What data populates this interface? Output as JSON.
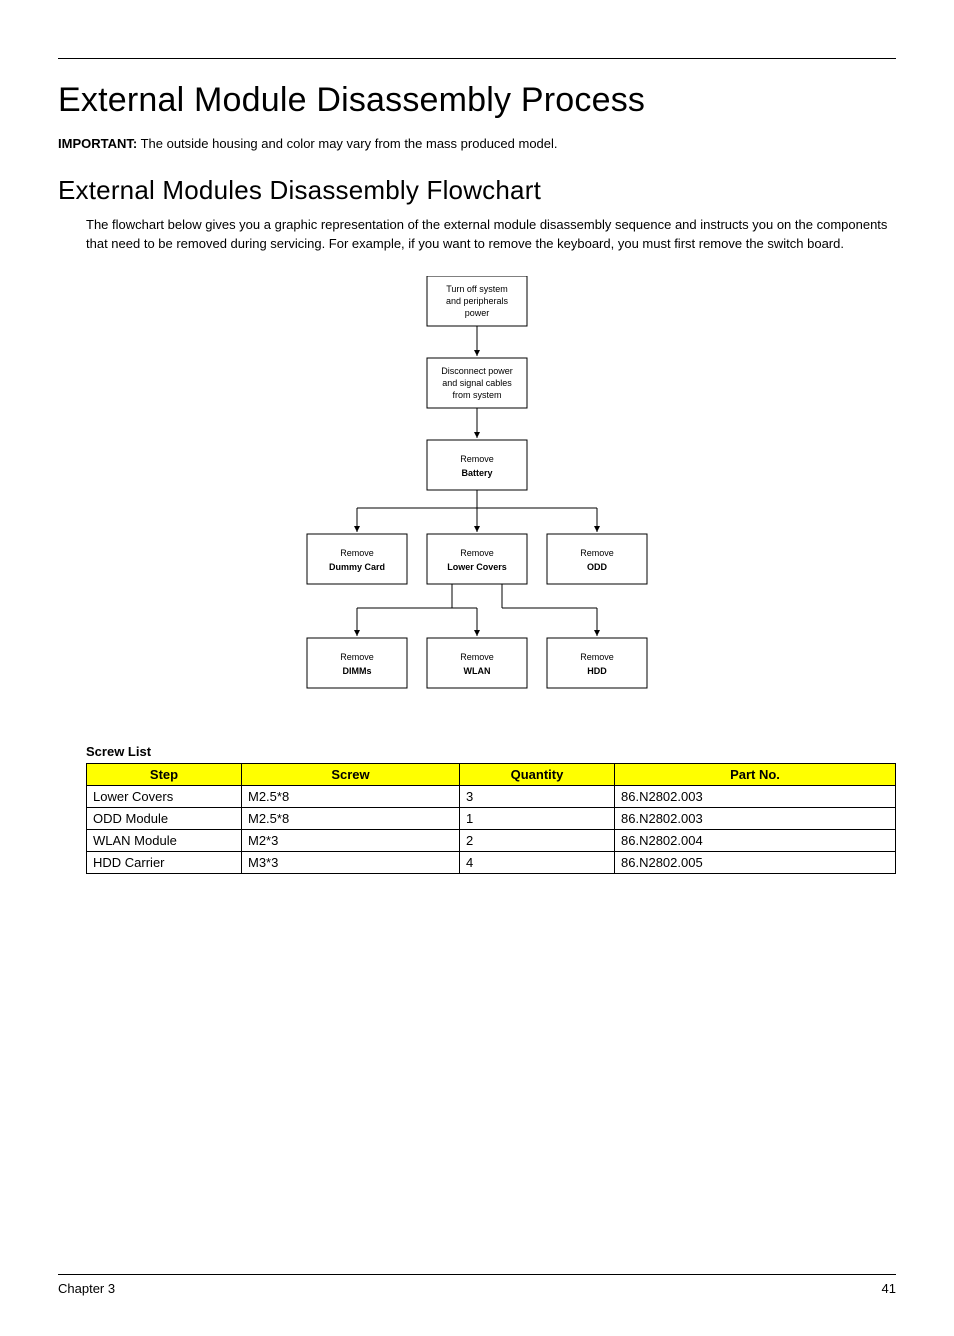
{
  "titles": {
    "h1": "External Module Disassembly Process",
    "h2": "External Modules Disassembly Flowchart"
  },
  "important": {
    "label": "IMPORTANT:",
    "text": " The outside housing and color may vary from the mass produced model."
  },
  "paragraph": "The flowchart below gives you a graphic representation of the external module disassembly sequence and instructs you on the components that need to be removed during servicing. For example, if you want to remove the keyboard, you must first remove the switch board.",
  "flow": {
    "n1_l1": "Turn off system",
    "n1_l2": "and peripherals",
    "n1_l3": "power",
    "n2_l1": "Disconnect power",
    "n2_l2": "and signal cables",
    "n2_l3": "from system",
    "n3_l1": "Remove",
    "n3_l2": "Battery",
    "r2_a_l1": "Remove",
    "r2_a_l2": "Dummy Card",
    "r2_b_l1": "Remove",
    "r2_b_l2": "Lower Covers",
    "r2_c_l1": "Remove",
    "r2_c_l2": "ODD",
    "r3_a_l1": "Remove",
    "r3_a_l2": "DIMMs",
    "r3_b_l1": "Remove",
    "r3_b_l2": "WLAN",
    "r3_c_l1": "Remove",
    "r3_c_l2": "HDD"
  },
  "screw": {
    "heading": "Screw List",
    "headers": {
      "step": "Step",
      "screw": "Screw",
      "qty": "Quantity",
      "part": "Part No."
    },
    "rows": [
      {
        "step": "Lower Covers",
        "screw": "M2.5*8",
        "qty": "3",
        "part": "86.N2802.003"
      },
      {
        "step": "ODD Module",
        "screw": "M2.5*8",
        "qty": "1",
        "part": "86.N2802.003"
      },
      {
        "step": "WLAN Module",
        "screw": "M2*3",
        "qty": "2",
        "part": "86.N2802.004"
      },
      {
        "step": "HDD Carrier",
        "screw": "M3*3",
        "qty": "4",
        "part": "86.N2802.005"
      }
    ]
  },
  "footer": {
    "left": "Chapter 3",
    "right": "41"
  }
}
